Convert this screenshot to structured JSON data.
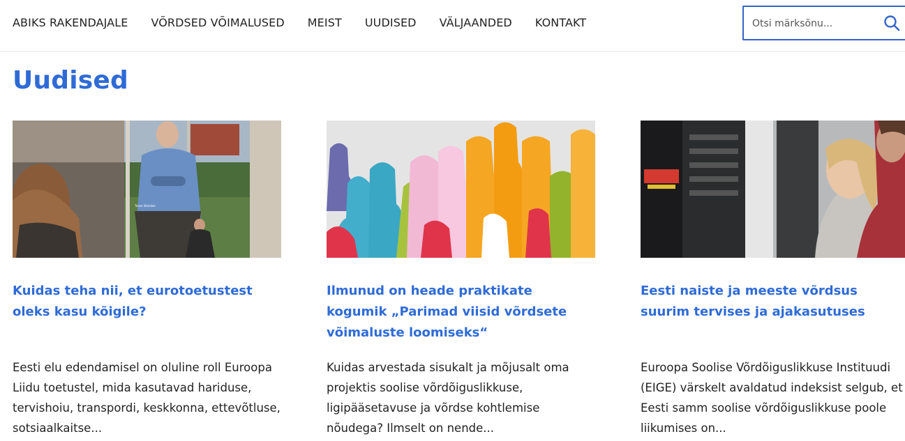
{
  "nav": {
    "items": [
      "ABIKS RAKENDAJALE",
      "VÕRDSED VÕIMALUSED",
      "MEIST",
      "UUDISED",
      "VÄLJAANDED",
      "KONTAKT"
    ]
  },
  "search": {
    "placeholder": "Otsi märksõnu..."
  },
  "page": {
    "title": "Uudised"
  },
  "cards": [
    {
      "title": "Kuidas teha nii, et eurotoetustest oleks kasu kõigile?",
      "text": "Eesti elu edendamisel on oluline roll Euroopa Liidu toetustel, mida kasutavad hariduse, tervishoiu, transpordi, keskkonna, ettevõtluse, sotsiaalkaitse..."
    },
    {
      "title": "Ilmunud on heade praktikate kogumik „Parimad viisid võrdsete võimaluste loomiseks“",
      "text": "Kuidas arvestada sisukalt ja mõjusalt oma projektis soolise võrdõiguslikkuse, ligipääsetavuse ja võrdse kohtlemise nõudega? Ilmselt on nende..."
    },
    {
      "title": "Eesti naiste ja meeste võrdsus suurim tervises ja ajakasutuses",
      "text": "Euroopa Soolise Võrdõiguslikkuse Instituudi (EIGE) värskelt avaldatud indeksist selgub, et Eesti samm soolise võrdõiguslikkuse poole liikumises on..."
    }
  ],
  "colors": {
    "accent": "#2f6bd6",
    "search_border": "#3264c8"
  },
  "icons": {
    "search": "magnifier-icon"
  }
}
